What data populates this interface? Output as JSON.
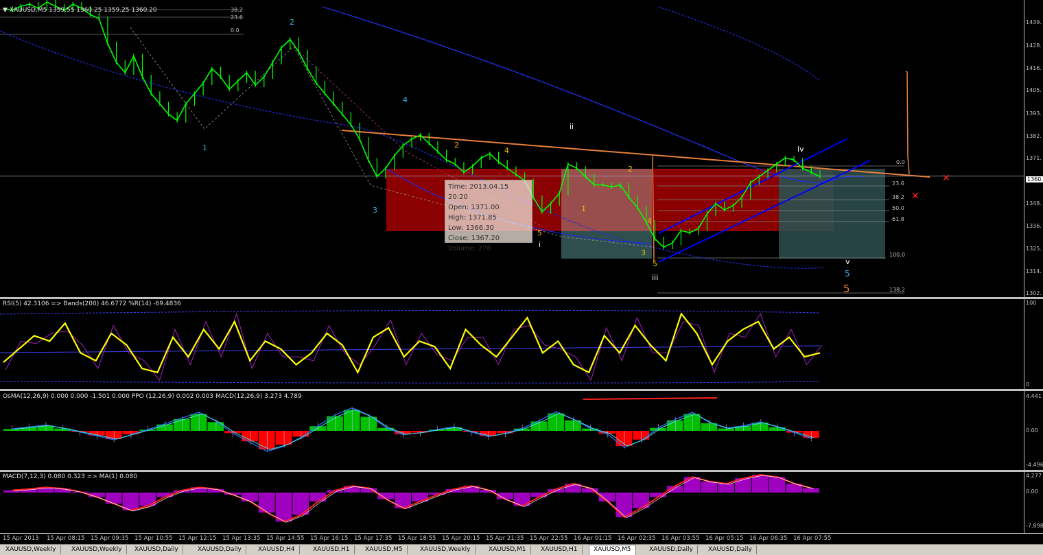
{
  "symbol_title": "XAUUSD,M5  1359.55 1360.25 1359.25 1360.20",
  "colors": {
    "price": "#00ff00",
    "ma_blue": "#1e2de0",
    "trend_orange": "#e8803a",
    "box_red": "#8b0000",
    "box_gray": "#2f4f4f",
    "rsi": "#ffff00",
    "osma_green": "#00c000",
    "osma_red": "#ff0000",
    "macd_purple": "#a000c0"
  },
  "tooltip": {
    "time": "Time: 2013.04.15 20:20",
    "open": "Open: 1371.00",
    "high": "High: 1371.85",
    "low": "Low:  1366.30",
    "close": "Close: 1367.20",
    "volume": "Volume: 276"
  },
  "price_axis": [
    "1439.",
    "1428.",
    "1416.",
    "1405.",
    "1393.",
    "1382.",
    "1371.",
    "1360.",
    "1348.",
    "1336.",
    "1325.",
    "1314.",
    "1302."
  ],
  "fib_top": [
    "38.2",
    "23.6",
    "0.0"
  ],
  "fib_right": [
    "0.0",
    "23.6",
    "38.2",
    "50.0",
    "61.8",
    "100.0",
    "138.2"
  ],
  "wave_labels": {
    "cyan": [
      "1",
      "2",
      "3",
      "4",
      "5"
    ],
    "white": [
      "ii",
      "i",
      "iii",
      "iv",
      "v"
    ],
    "gold": [
      "1",
      "2",
      "4",
      "4",
      "5",
      "2",
      "3",
      "5",
      "5"
    ]
  },
  "rsi_title": "RSI(5) 42.3106  => Bands(200) 46.6772  %R(14) -69.4836",
  "rsi_axis": [
    "100",
    "0"
  ],
  "osma_title": "OsMA(12,26,9) 0.000 0.000 -1.501 0.000  PPO (12,26,9) 0.002 0.003  MACD(12,26,9) 3.273 4.789",
  "osma_axis": [
    "4.441",
    "0.00",
    "-4.496"
  ],
  "macd_title": "MACD(7,12,3) 0.080 0.323  => MA(1) 0.080",
  "macd_axis": [
    "4.277",
    "0.00",
    "-7.898"
  ],
  "time_labels": [
    "15 Apr 2013",
    "15 Apr 08:15",
    "15 Apr 09:35",
    "15 Apr 10:55",
    "15 Apr 12:15",
    "15 Apr 13:35",
    "15 Apr 14:55",
    "15 Apr 16:15",
    "15 Apr 17:35",
    "15 Apr 18:55",
    "15 Apr 20:15",
    "15 Apr 21:35",
    "15 Apr 22:55",
    "16 Apr 01:15",
    "16 Apr 02:35",
    "16 Apr 03:55",
    "16 Apr 05:15",
    "16 Apr 06:35",
    "16 Apr 07:55"
  ],
  "tabs": [
    "XAUUSD,Weekly",
    "XAUUSD,Weekly",
    "XAUUSD,Daily",
    "XAUUSD,Daily",
    "XAUUSD,H4",
    "XAUUSD,H1",
    "XAUUSD,M5",
    "XAUUSD,Weekly",
    "XAUUSD,M1",
    "XAUUSD,H1",
    "XAUUSD,M5",
    "XAUUSD,Daily",
    "XAUUSD,Daily"
  ],
  "active_tab": 10,
  "chart_data": {
    "type": "line",
    "title": "XAUUSD,M5",
    "ylim": [
      1302,
      1445
    ],
    "price_close": [
      1441,
      1440,
      1442,
      1443,
      1441,
      1444,
      1442,
      1440,
      1443,
      1441,
      1438,
      1436,
      1424,
      1415,
      1410,
      1418,
      1408,
      1400,
      1395,
      1390,
      1387,
      1395,
      1400,
      1405,
      1412,
      1408,
      1402,
      1406,
      1410,
      1404,
      1408,
      1415,
      1422,
      1426,
      1420,
      1412,
      1405,
      1400,
      1395,
      1390,
      1385,
      1378,
      1368,
      1360,
      1364,
      1370,
      1375,
      1378,
      1380,
      1376,
      1372,
      1368,
      1366,
      1362,
      1365,
      1369,
      1371,
      1367,
      1364,
      1361,
      1358,
      1350,
      1343,
      1347,
      1352,
      1366,
      1364,
      1360,
      1356,
      1356,
      1355,
      1356,
      1350,
      1345,
      1338,
      1330,
      1326,
      1328,
      1334,
      1333,
      1335,
      1342,
      1347,
      1344,
      1346,
      1350,
      1357,
      1360,
      1363,
      1366,
      1369,
      1368,
      1364,
      1362,
      1360
    ],
    "ma_blue_upper": [
      1445,
      1443,
      1440,
      1437,
      1433,
      1429,
      1424,
      1419,
      1413,
      1406,
      1399,
      1392,
      1385,
      1378,
      1372,
      1366,
      1362,
      1360
    ],
    "current_price": 1360.2,
    "rsi": [
      28,
      45,
      62,
      55,
      78,
      40,
      30,
      65,
      50,
      20,
      15,
      60,
      35,
      70,
      45,
      80,
      30,
      55,
      45,
      25,
      40,
      65,
      50,
      15,
      60,
      72,
      35,
      55,
      48,
      20,
      70,
      50,
      35,
      60,
      85,
      40,
      55,
      25,
      15,
      62,
      40,
      75,
      50,
      30,
      90,
      65,
      25,
      55,
      70,
      80,
      45,
      60,
      35,
      40
    ],
    "osma": [
      0.3,
      0.6,
      0.9,
      0.4,
      -0.2,
      -0.8,
      -1.4,
      -0.6,
      0.2,
      1.1,
      2.0,
      2.9,
      1.5,
      -0.4,
      -1.8,
      -3.2,
      -2.4,
      -1.0,
      0.8,
      2.5,
      3.6,
      2.4,
      0.5,
      -0.6,
      -0.3,
      0.2,
      0.6,
      -0.2,
      -0.9,
      -0.4,
      0.4,
      1.6,
      3.0,
      1.8,
      0.4,
      -0.5,
      -2.6,
      -1.5,
      0.5,
      1.8,
      2.9,
      1.3,
      0.4,
      0.8,
      1.4,
      0.6,
      -0.3,
      -1.2
    ],
    "macd_hist": [
      0.5,
      0.8,
      1.2,
      0.9,
      0.2,
      -1.0,
      -2.5,
      -4.0,
      -3.0,
      -1.0,
      0.5,
      1.2,
      0.8,
      -0.5,
      -2.0,
      -4.5,
      -6.5,
      -5.0,
      -2.0,
      0.5,
      1.5,
      1.0,
      -1.5,
      -3.5,
      -2.0,
      -0.5,
      0.8,
      1.5,
      0.6,
      -1.5,
      -3.0,
      -1.0,
      0.8,
      2.0,
      1.0,
      -2.0,
      -5.5,
      -3.5,
      -1.0,
      1.5,
      3.5,
      2.5,
      2.0,
      3.2,
      4.0,
      3.5,
      2.0,
      1.0
    ]
  }
}
